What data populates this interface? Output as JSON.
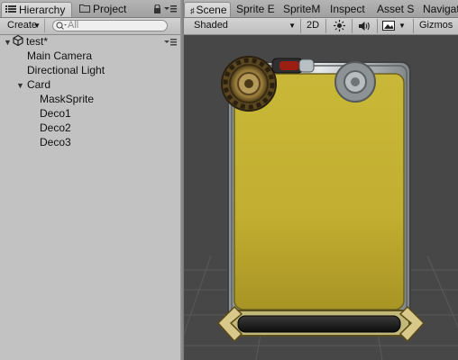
{
  "hierarchy": {
    "tab_label": "Hierarchy",
    "project_tab_label": "Project",
    "create_label": "Create",
    "search_placeholder": "All",
    "scene_name": "test*",
    "items": [
      {
        "label": "Main Camera"
      },
      {
        "label": "Directional Light"
      },
      {
        "label": "Card"
      },
      {
        "label": "MaskSprite"
      },
      {
        "label": "Deco1"
      },
      {
        "label": "Deco2"
      },
      {
        "label": "Deco3"
      }
    ]
  },
  "scene_view": {
    "tabs": [
      {
        "label": "Scene"
      },
      {
        "label": "Sprite E"
      },
      {
        "label": "SpriteM"
      },
      {
        "label": "Inspect"
      },
      {
        "label": "Asset S"
      },
      {
        "label": "Navigati"
      }
    ],
    "shading_mode": "Shaded",
    "mode_2d_label": "2D",
    "gizmos_label": "Gizmos"
  },
  "colors": {
    "panel_bg": "#c2c2c2",
    "scene_bg": "#474747",
    "card_gold": "#c5b233"
  }
}
